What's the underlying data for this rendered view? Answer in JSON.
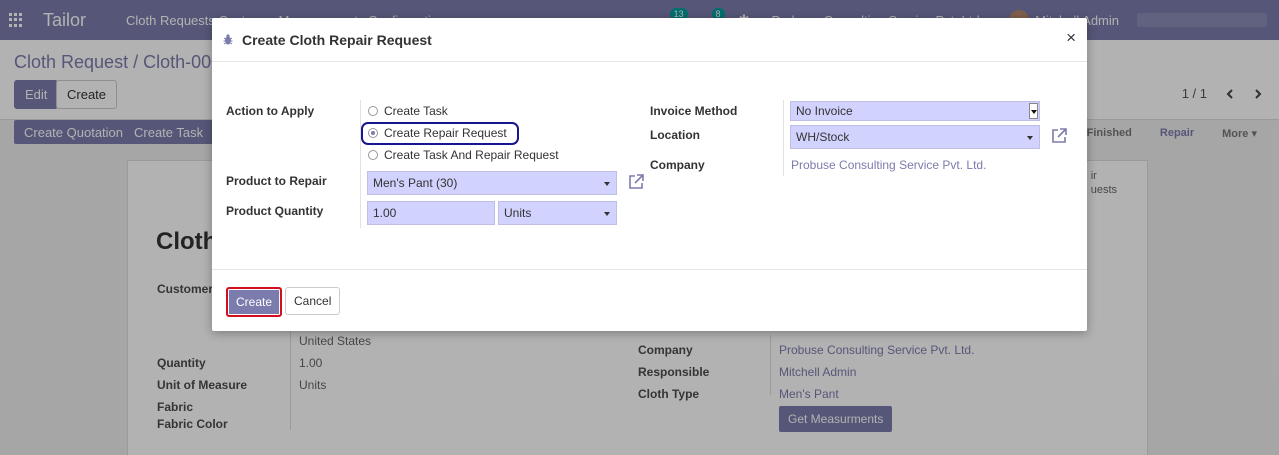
{
  "navbar": {
    "brand": "Tailor",
    "menu_text": "Cloth Requests    Customer Measurements    Configuration",
    "notification_count": "13",
    "activity_count": "8",
    "company": "Probuse Consulting Service Pvt. Ltd.",
    "user": "Mitchell Admin"
  },
  "control_panel": {
    "breadcrumb": "Cloth Request / Cloth-0001",
    "edit_label": "Edit",
    "create_label": "Create",
    "pager": "1 / 1"
  },
  "statusbar": {
    "buttons": [
      "Create Quotation",
      "Create Task"
    ],
    "stages": [
      "Finished",
      "Repair",
      "More ▾"
    ]
  },
  "sheet": {
    "stat_button": "ir\nuests",
    "title": "Cloth",
    "customer_label": "Customer",
    "country": "United States",
    "quantity_label": "Quantity",
    "quantity_value": "1.00",
    "uom_label": "Unit of Measure",
    "uom_value": "Units",
    "fabric_label": "Fabric",
    "fabric_color_label": "Fabric Color",
    "company_label": "Company",
    "company_value": "Probuse Consulting Service Pvt. Ltd.",
    "responsible_label": "Responsible",
    "responsible_value": "Mitchell Admin",
    "cloth_type_label": "Cloth Type",
    "cloth_type_value": "Men's Pant",
    "get_measurements_label": "Get Measurments"
  },
  "modal": {
    "title": "Create Cloth Repair Request",
    "close": "×",
    "action_label": "Action to Apply",
    "actions": [
      {
        "label": "Create Task",
        "checked": false
      },
      {
        "label": "Create Repair Request",
        "checked": true
      },
      {
        "label": "Create Task And Repair Request",
        "checked": false
      }
    ],
    "product_label": "Product to Repair",
    "product_value": "Men's Pant (30)",
    "quantity_label": "Product Quantity",
    "quantity_value": "1.00",
    "uom_value": "Units",
    "invoice_label": "Invoice Method",
    "invoice_value": "No Invoice",
    "location_label": "Location",
    "location_value": "WH/Stock",
    "company_label": "Company",
    "company_value": "Probuse Consulting Service Pvt. Ltd.",
    "create_label": "Create",
    "cancel_label": "Cancel"
  },
  "colors": {
    "brand": "#7c7bad",
    "required_field": "#d2d2ff",
    "highlight_outline": "#16168f",
    "create_outline": "#d10f1f"
  }
}
